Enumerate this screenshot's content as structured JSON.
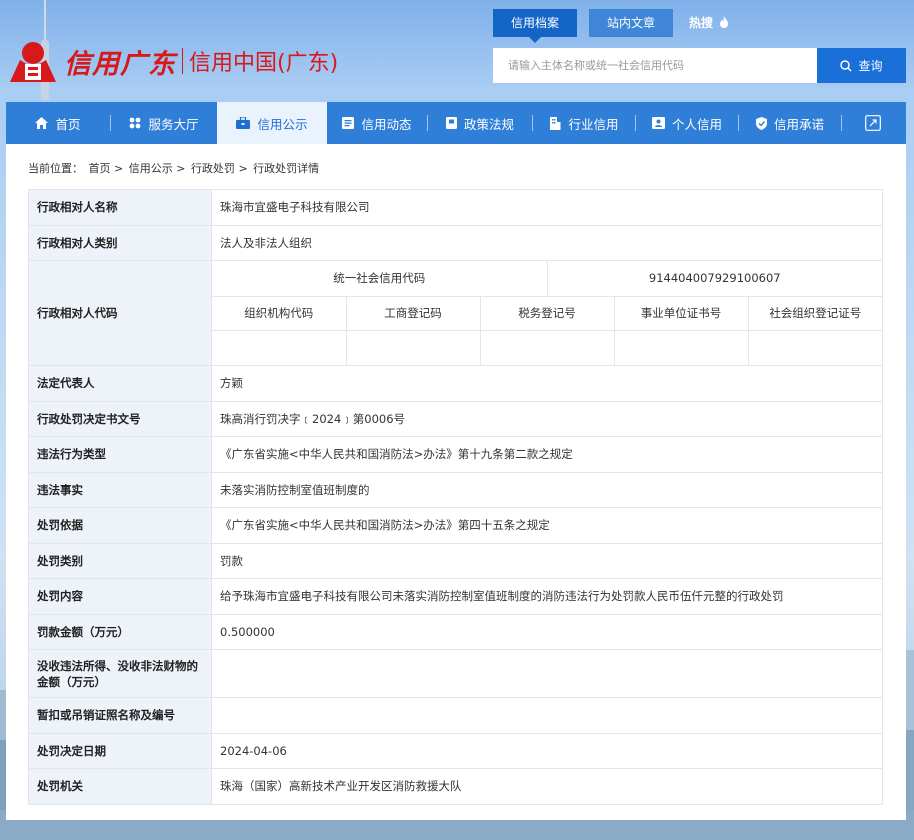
{
  "header": {
    "logo_main": "信用广东",
    "logo_sub": "信用中国(广东)",
    "top_tabs": [
      {
        "label": "信用档案",
        "active": true
      },
      {
        "label": "站内文章",
        "active": false
      }
    ],
    "hot_label": "热搜",
    "search_placeholder": "请输入主体名称或统一社会信用代码",
    "search_button": "查询"
  },
  "nav": {
    "items": [
      {
        "label": "首页",
        "icon": "home-icon"
      },
      {
        "label": "服务大厅",
        "icon": "grid-icon"
      },
      {
        "label": "信用公示",
        "icon": "briefcase-icon",
        "active": true
      },
      {
        "label": "信用动态",
        "icon": "news-icon"
      },
      {
        "label": "政策法规",
        "icon": "book-icon"
      },
      {
        "label": "行业信用",
        "icon": "building-icon"
      },
      {
        "label": "个人信用",
        "icon": "person-card-icon"
      },
      {
        "label": "信用承诺",
        "icon": "shield-check-icon"
      }
    ]
  },
  "breadcrumb": {
    "prefix": "当前位置：",
    "items": [
      "首页",
      "信用公示",
      "行政处罚",
      "行政处罚详情"
    ],
    "separator": ">"
  },
  "detail": {
    "rows": [
      {
        "label": "行政相对人名称",
        "value": "珠海市宜盛电子科技有限公司"
      },
      {
        "label": "行政相对人类别",
        "value": "法人及非法人组织"
      }
    ],
    "code_label": "行政相对人代码",
    "code": {
      "uscc_label": "统一社会信用代码",
      "uscc_value": "914404007929100607",
      "sub_headers": [
        "组织机构代码",
        "工商登记码",
        "税务登记号",
        "事业单位证书号",
        "社会组织登记证号"
      ],
      "sub_values": [
        "",
        "",
        "",
        "",
        ""
      ]
    },
    "rows2": [
      {
        "label": "法定代表人",
        "value": "方颖"
      },
      {
        "label": "行政处罚决定书文号",
        "value": "珠高消行罚决字﹝2024﹞第0006号"
      },
      {
        "label": "违法行为类型",
        "value": "《广东省实施<中华人民共和国消防法>办法》第十九条第二款之规定"
      },
      {
        "label": "违法事实",
        "value": "未落实消防控制室值班制度的"
      },
      {
        "label": "处罚依据",
        "value": "《广东省实施<中华人民共和国消防法>办法》第四十五条之规定"
      },
      {
        "label": "处罚类别",
        "value": "罚款"
      },
      {
        "label": "处罚内容",
        "value": "给予珠海市宜盛电子科技有限公司未落实消防控制室值班制度的消防违法行为处罚款人民币伍仟元整的行政处罚"
      },
      {
        "label": "罚款金额（万元）",
        "value": "0.500000"
      },
      {
        "label": "没收违法所得、没收非法财物的金额（万元）",
        "value": ""
      },
      {
        "label": "暂扣或吊销证照名称及编号",
        "value": ""
      },
      {
        "label": "处罚决定日期",
        "value": "2024-04-06"
      },
      {
        "label": "处罚机关",
        "value": "珠海（国家）高新技术产业开发区消防救援大队"
      }
    ]
  },
  "colors": {
    "brand_red": "#d8181b",
    "nav_blue": "#2f7fd8",
    "label_bg": "#eef3fa"
  }
}
